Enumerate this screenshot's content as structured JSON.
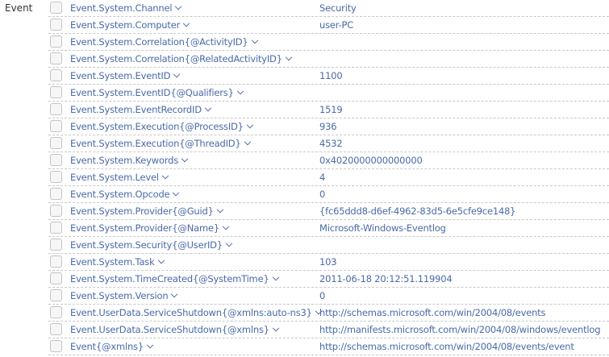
{
  "section_label": "Event",
  "rows": [
    {
      "field": "Event.System.Channel",
      "value": "Security"
    },
    {
      "field": "Event.System.Computer",
      "value": "user-PC"
    },
    {
      "field": "Event.System.Correlation{@ActivityID}",
      "value": ""
    },
    {
      "field": "Event.System.Correlation{@RelatedActivityID}",
      "value": ""
    },
    {
      "field": "Event.System.EventID",
      "value": "1100"
    },
    {
      "field": "Event.System.EventID{@Qualifiers}",
      "value": ""
    },
    {
      "field": "Event.System.EventRecordID",
      "value": "1519"
    },
    {
      "field": "Event.System.Execution{@ProcessID}",
      "value": "936"
    },
    {
      "field": "Event.System.Execution{@ThreadID}",
      "value": "4532"
    },
    {
      "field": "Event.System.Keywords",
      "value": "0x4020000000000000"
    },
    {
      "field": "Event.System.Level",
      "value": "4"
    },
    {
      "field": "Event.System.Opcode",
      "value": "0"
    },
    {
      "field": "Event.System.Provider{@Guid}",
      "value": "{fc65ddd8-d6ef-4962-83d5-6e5cfe9ce148}"
    },
    {
      "field": "Event.System.Provider{@Name}",
      "value": "Microsoft-Windows-Eventlog"
    },
    {
      "field": "Event.System.Security{@UserID}",
      "value": ""
    },
    {
      "field": "Event.System.Task",
      "value": "103"
    },
    {
      "field": "Event.System.TimeCreated{@SystemTime}",
      "value": "2011-06-18 20:12:51.119904"
    },
    {
      "field": "Event.System.Version",
      "value": "0"
    },
    {
      "field": "Event.UserData.ServiceShutdown{@xmlns:auto-ns3}",
      "value": "http://schemas.microsoft.com/win/2004/08/events"
    },
    {
      "field": "Event.UserData.ServiceShutdown{@xmlns}",
      "value": "http://manifests.microsoft.com/win/2004/08/windows/eventlog"
    },
    {
      "field": "Event{@xmlns}",
      "value": "http://schemas.microsoft.com/win/2004/08/events/event"
    }
  ]
}
